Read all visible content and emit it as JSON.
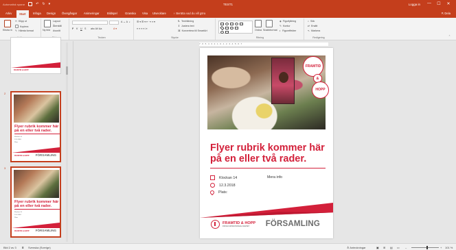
{
  "titlebar": {
    "autosave": "Automatisk sparar",
    "doc_title": "TEST1",
    "signin": "Logga in",
    "win_min": "—",
    "win_max": "☐",
    "win_close": "✕"
  },
  "ribbon_tabs": [
    "Arkiv",
    "Start",
    "Infoga",
    "Design",
    "Övergångar",
    "Animeringar",
    "Bildspel",
    "Granska",
    "Visa",
    "Utvecklare"
  ],
  "active_tab": "Start",
  "tell_me": "Berätta vad du vill göra",
  "share": "Dela",
  "ribbon": {
    "clipboard": {
      "cut": "Klipp ut",
      "copy": "Kopiera",
      "format_painter": "Hämta format",
      "paste": "Klistra in",
      "label": "Urklipp"
    },
    "slides": {
      "new_slide": "Ny bild",
      "layout": "Layout",
      "reset": "Återställ",
      "section": "Avsnitt",
      "label": "Bilder"
    },
    "font": {
      "bold": "F",
      "italic": "K",
      "underline": "U",
      "strike": "S",
      "label": "Tecken"
    },
    "paragraph": {
      "text_direction": "Textriktning",
      "align_text": "Justera text",
      "smartart": "Konvertera till SmartArt",
      "label": "Stycke"
    },
    "drawing": {
      "arrange": "Ordna",
      "quick_styles": "Snabbformat",
      "fill": "Figurfyllning",
      "outline": "Kontur",
      "effects": "Figureffekter",
      "label": "Ritning"
    },
    "editing": {
      "find": "Sök",
      "replace": "Ersätt",
      "select": "Markera",
      "label": "Redigering"
    }
  },
  "ruler_text": "7 · 6 · 5 · 4 · 3 · 2 · 1 · 0 · 1 · 2 · 3 · 4 · 5 · 6 · 7",
  "thumbnails": [
    {
      "number": "",
      "footer": "FRAMTID & HOPP",
      "fors": ""
    },
    {
      "number": "2",
      "title": "Flyer rubrik kommer här på en eller två rader.",
      "row1": "Klockan 14",
      "row2": "12.3.2018",
      "row3": "Plats",
      "footer": "FRAMTID & HOPP",
      "fors": "FÖRSAMLING"
    },
    {
      "number": "3",
      "title": "Flyer rubrik kommer här på en eller två rader.",
      "row1": "Klockan 14",
      "row2": "12.3.2018",
      "row3": "Plats",
      "footer": "FRAMTID & HOPP",
      "fors": "FÖRSAMLING"
    }
  ],
  "slide": {
    "badge_top": "FRAMTID",
    "badge_mid": "&",
    "badge_bottom": "HOPP",
    "title": "Flyer rubrik kommer här på en eller två rader.",
    "rows": [
      {
        "icon": "calendar-icon",
        "text": "Klockan 14"
      },
      {
        "icon": "clock-icon",
        "text": "12.3.2018"
      },
      {
        "icon": "location-pin-icon",
        "text": "Plats:"
      }
    ],
    "more_info": "Mera info",
    "logo_name": "FRAMTID & HOPP",
    "logo_sub": "FINSKA MISSIONSSÄLLSKAPET",
    "forsamling": "FÖRSAMLING"
  },
  "status": {
    "slide_of": "Bild 2 av 3",
    "language": "Svenska (Sverige)",
    "notes": "Anteckningar",
    "zoom": "101 %"
  },
  "colors": {
    "accent": "#c43e1c",
    "brand_red": "#d3203a"
  }
}
